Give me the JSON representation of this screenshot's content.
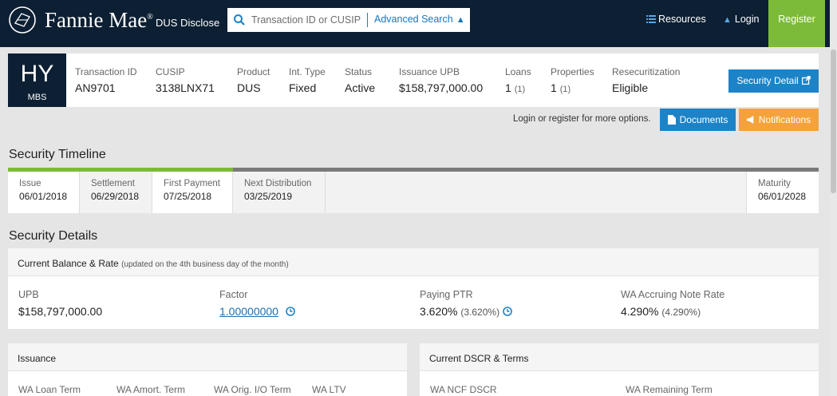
{
  "header": {
    "brand": "Fannie Mae",
    "brand_mark": "®",
    "sub_brand": "DUS Disclose",
    "search": {
      "placeholder": "Transaction ID or CUSIP",
      "advanced_label": "Advanced Search"
    },
    "nav": {
      "resources": "Resources",
      "login": "Login",
      "register": "Register"
    }
  },
  "security": {
    "badge_code": "HY",
    "badge_type": "MBS",
    "fields": [
      {
        "label": "Transaction ID",
        "value": "AN9701"
      },
      {
        "label": "CUSIP",
        "value": "3138LNX71"
      },
      {
        "label": "Product",
        "value": "DUS"
      },
      {
        "label": "Int. Type",
        "value": "Fixed"
      },
      {
        "label": "Status",
        "value": "Active"
      },
      {
        "label": "Issuance UPB",
        "value": "$158,797,000.00"
      },
      {
        "label": "Loans",
        "value": "1",
        "count": "(1)"
      },
      {
        "label": "Properties",
        "value": "1",
        "count": "(1)"
      },
      {
        "label": "Resecuritization",
        "value": "Eligible"
      }
    ],
    "detail_button": "Security Detail"
  },
  "actions": {
    "login_note": "Login or register for more options.",
    "documents": "Documents",
    "notifications": "Notifications"
  },
  "timeline": {
    "title": "Security Timeline",
    "items": [
      {
        "label": "Issue",
        "date": "06/01/2018"
      },
      {
        "label": "Settlement",
        "date": "06/29/2018"
      },
      {
        "label": "First Payment",
        "date": "07/25/2018"
      },
      {
        "label": "Next Distribution",
        "date": "03/25/2019"
      },
      {
        "label": "Maturity",
        "date": "06/01/2028"
      }
    ]
  },
  "details": {
    "title": "Security Details",
    "balance_panel": {
      "title": "Current Balance & Rate",
      "note": "(updated on the 4th business day of the month)",
      "fields": [
        {
          "label": "UPB",
          "value": "$158,797,000.00"
        },
        {
          "label": "Factor",
          "value": "1.00000000"
        },
        {
          "label": "Paying PTR",
          "value": "3.620%",
          "sub": "(3.620%)"
        },
        {
          "label": "WA Accruing Note Rate",
          "value": "4.290%",
          "sub": "(4.290%)"
        }
      ]
    },
    "issuance_panel": {
      "title": "Issuance",
      "fields": [
        "WA Loan Term",
        "WA Amort. Term",
        "WA Orig. I/O Term",
        "WA LTV"
      ]
    },
    "dscr_panel": {
      "title": "Current DSCR & Terms",
      "fields": [
        "WA NCF DSCR",
        "WA Remaining Term"
      ]
    }
  },
  "colors": {
    "navy": "#0c1f33",
    "green": "#7cbb3a",
    "blue": "#1d83c7",
    "orange": "#f5a23a"
  }
}
